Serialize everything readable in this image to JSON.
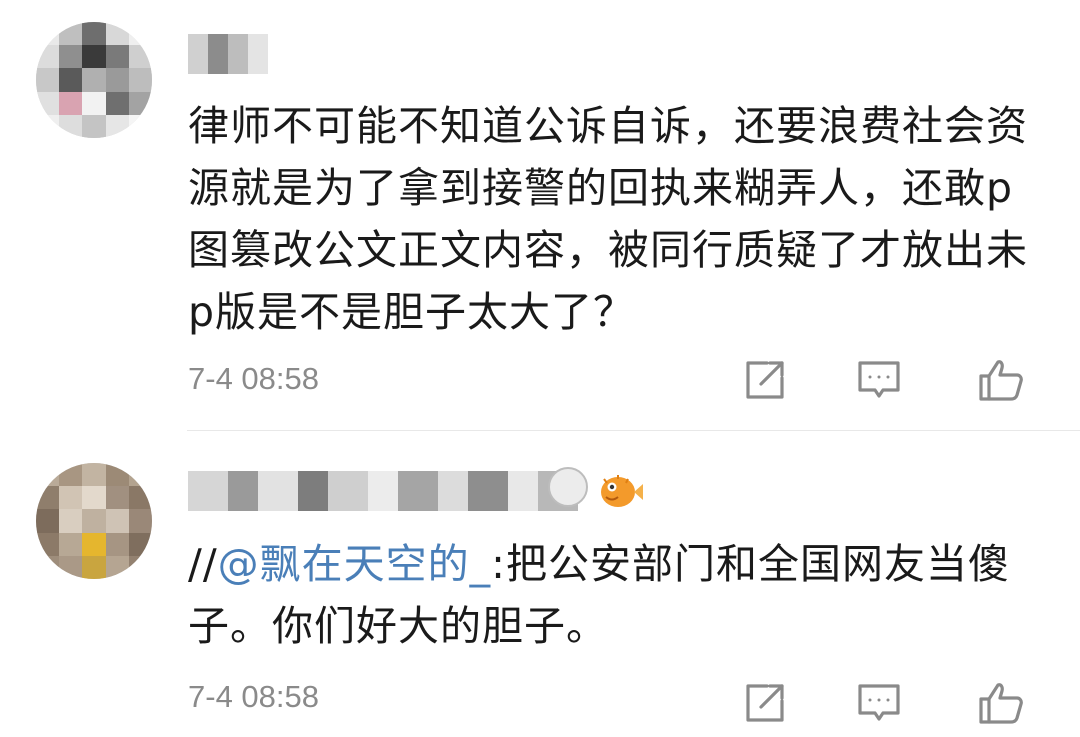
{
  "comments": [
    {
      "text": "律师不可能不知道公诉自诉，还要浪费社会资源就是为了拿到接警的回执来糊弄人，还敢p图篡改公文正文内容，被同行质疑了才放出未p版是不是胆子太大了？",
      "time": "7-4 08:58"
    },
    {
      "prefix": "//",
      "mention": "@飘在天空的_",
      "text": ":把公安部门和全国网友当傻子。你们好大的胆子。",
      "time": "7-4 08:58"
    }
  ],
  "icons": {
    "share": "share-icon",
    "reply": "comment-icon",
    "like": "thumbs-up-icon"
  },
  "colors": {
    "mention": "#4a7fb8",
    "timestamp": "#8a8a8a",
    "icon": "#8a8a8a"
  }
}
